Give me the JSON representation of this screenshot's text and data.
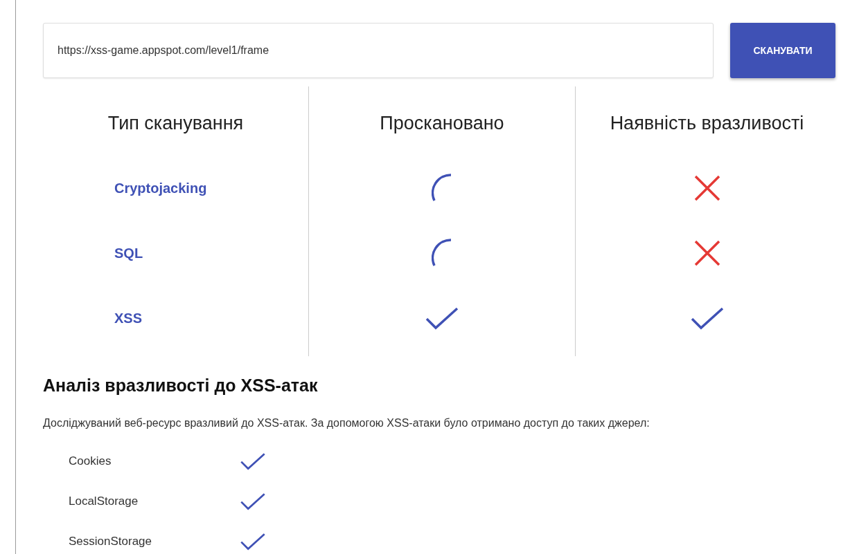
{
  "scan_form": {
    "url": "https://xss-game.appspot.com/level1/frame",
    "button": "СКАНУВАТИ"
  },
  "results_table": {
    "columns": [
      "Тип сканування",
      "Проскановано",
      "Наявність вразливості"
    ],
    "rows": [
      {
        "name": "Cryptojacking",
        "scanned": false,
        "vulnerable": false
      },
      {
        "name": "SQL",
        "scanned": false,
        "vulnerable": false
      },
      {
        "name": "XSS",
        "scanned": true,
        "vulnerable": true
      }
    ]
  },
  "analysis": {
    "title": "Аналіз вразливості до XSS-атак",
    "text": "Досліджуваний веб-ресурс вразливий до XSS-атак. За допомогою XSS-атаки було отримано доступ до таких джерел:",
    "sources": [
      {
        "label": "Cookies",
        "accessed": true
      },
      {
        "label": "LocalStorage",
        "accessed": true
      },
      {
        "label": "SessionStorage",
        "accessed": true
      }
    ]
  }
}
